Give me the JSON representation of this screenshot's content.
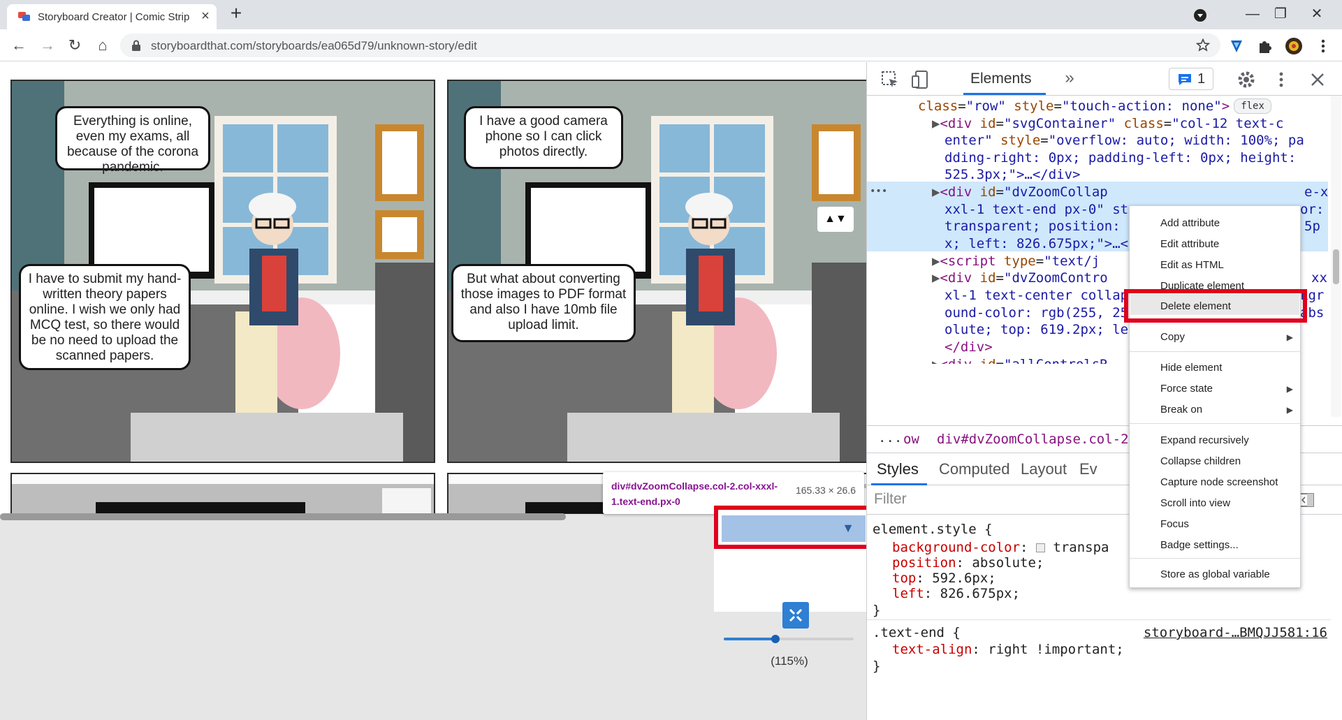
{
  "browser": {
    "tab_title": "Storyboard Creator | Comic Strip",
    "tab_close": "×",
    "new_tab": "+",
    "url": "storyboardthat.com/storyboards/ea065d79/unknown-story/edit",
    "controls": {
      "minimize": "—",
      "maximize": "❐",
      "close": "✕"
    },
    "nav": {
      "back": "←",
      "forward": "→",
      "reload": "↻",
      "home": "⌂"
    }
  },
  "storyboard": {
    "panel1": {
      "bubble_top": "Everything is online, even my exams, all because of the corona pandemic.",
      "bubble_bottom": "I have to submit my hand-written theory papers online. I wish we only had MCQ test, so there would be no need to upload the scanned papers."
    },
    "panel2": {
      "bubble_top": "I have a good camera phone so I can click photos directly.",
      "bubble_bottom": "But what about converting those images to PDF format and also I have 10mb file upload limit.",
      "arrows": "▲▼"
    }
  },
  "zoom_control": {
    "tooltip_name": "div#dvZoomCollapse.col-2.col-xxxl-1.text-end.px-0",
    "tooltip_size": "165.33 × 26.6",
    "collapse_arrow": "▼",
    "zoom_label": "(115%)",
    "zoom_fraction": 0.4
  },
  "devtools": {
    "tab_elements": "Elements",
    "more_tabs": "»",
    "issues_count": "1",
    "dom_lines": [
      {
        "pre": "    ",
        "a1": "class",
        "v1": "\"row\"",
        "a2": " style",
        "v2": "\"touch-action: none\"",
        "post": ">",
        "badge": "flex"
      },
      {
        "pre": "▶",
        "tag": "<div",
        "a1": " id",
        "v1": "\"svgContainer\"",
        "a2": " class",
        "v2": "\"col-12 text-c"
      },
      {
        "cont": "enter\"",
        "a1": " style",
        "v1": "\"overflow: auto; width: 100%; pa"
      },
      {
        "cont": "dding-right: 0px; padding-left: 0px; height:"
      },
      {
        "cont": "525.3px;\">…</div>"
      },
      {
        "pre": "▶",
        "tag": "<div",
        "a1": " id",
        "v1": "\"dvZoomCollap",
        "extra": "e-x"
      },
      {
        "cont": "xxl-1 text-end px-0\" st",
        "extra": "or:"
      },
      {
        "cont": "transparent; position: ",
        "extra": "5p"
      },
      {
        "cont": "x; left: 826.675px;\">…<",
        "extra": ""
      },
      {
        "pre": "▶",
        "tag": "<script",
        "a1": " type",
        "v1": "\"text/j"
      },
      {
        "pre": "▶",
        "tag": "<div",
        "a1": " id",
        "v1": "\"dvZoomContro",
        "extra": "xx"
      },
      {
        "cont": "xl-1 text-center collap",
        "extra": "kgr"
      },
      {
        "cont": "ound-color: rgb(255, 25",
        "extra": "abs"
      },
      {
        "cont": "olute; top: 619.2px; le"
      },
      {
        "cont": "</div>"
      },
      {
        "pre": "▶",
        "tag": "<div",
        "a1": " id",
        "v1": "\"allControlsR"
      }
    ],
    "dots": "•••",
    "breadcrumb_dots": "...",
    "breadcrumb_prev": "ow",
    "breadcrumb_current": "div#dvZoomCollapse.col-2.",
    "styles_tabs": [
      "Styles",
      "Computed",
      "Layout",
      "Ev"
    ],
    "filter_placeholder": "Filter",
    "element_style": {
      "selector": "element.style {",
      "props": [
        {
          "name": "background-color",
          "value": "transpa"
        },
        {
          "name": "position",
          "value": "absolute;"
        },
        {
          "name": "top",
          "value": "592.6px;"
        },
        {
          "name": "left",
          "value": "826.675px;"
        }
      ],
      "close": "}"
    },
    "text_end_rule": {
      "selector": ".text-end {",
      "source": "storyboard-…BMQJJ581:16",
      "prop": "text-align",
      "value": "right !important;",
      "close": "}"
    }
  },
  "context_menu": {
    "items": [
      {
        "label": "Add attribute"
      },
      {
        "label": "Edit attribute"
      },
      {
        "label": "Edit as HTML"
      },
      {
        "label": "Duplicate element"
      },
      {
        "label": "Delete element",
        "highlighted": true
      },
      {
        "label": "Copy",
        "submenu": true
      },
      {
        "label": "Hide element"
      },
      {
        "label": "Force state",
        "submenu": true
      },
      {
        "label": "Break on",
        "submenu": true
      },
      {
        "label": "Expand recursively"
      },
      {
        "label": "Collapse children"
      },
      {
        "label": "Capture node screenshot"
      },
      {
        "label": "Scroll into view"
      },
      {
        "label": "Focus"
      },
      {
        "label": "Badge settings..."
      },
      {
        "label": "Store as global variable"
      }
    ],
    "submenu_arrow": "▶"
  },
  "colors": {
    "highlight_red": "#e0001b",
    "selection_blue": "#cfe8fc",
    "accent": "#1a73e8"
  }
}
